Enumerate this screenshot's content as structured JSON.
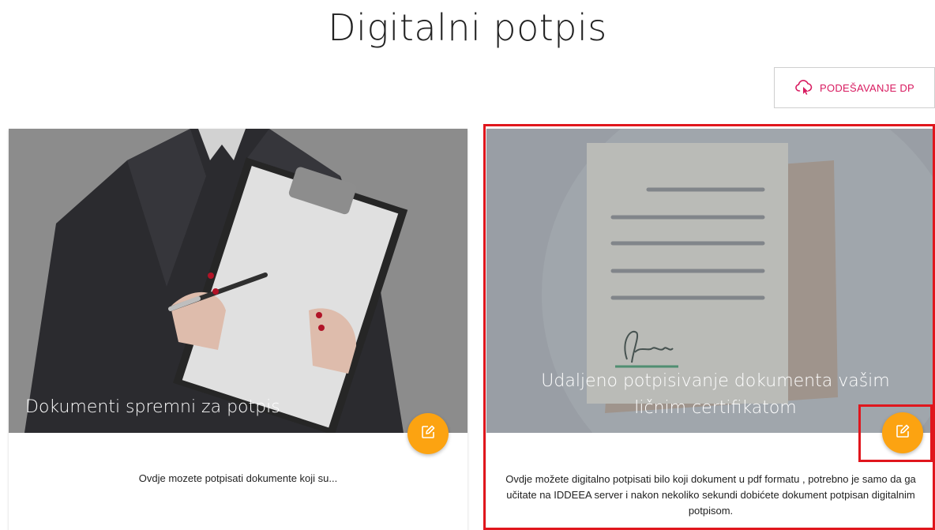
{
  "page": {
    "title": "Digitalni potpis"
  },
  "toolbar": {
    "settings_label": "PODEŠAVANJE DP",
    "settings_icon": "cloud-pointer-icon"
  },
  "cards": [
    {
      "title": "Dokumenti spremni za potpis",
      "description": "Ovdje mozete potpisati dokumente koji su...",
      "action_icon": "edit-icon"
    },
    {
      "title": "Udaljeno potpisivanje dokumenta vašim ličnim certifikatom",
      "description": "Ovdje možete digitalno potpisati bilo koji dokument u pdf formatu , potrebno je samo da ga učitate na IDDEEA server i nakon nekoliko sekundi dobićete dokument potpisan digitalnim potpisom.",
      "action_icon": "edit-icon"
    }
  ],
  "colors": {
    "accent": "#d81b60",
    "fab": "#fca311",
    "highlight": "#e0161d"
  }
}
